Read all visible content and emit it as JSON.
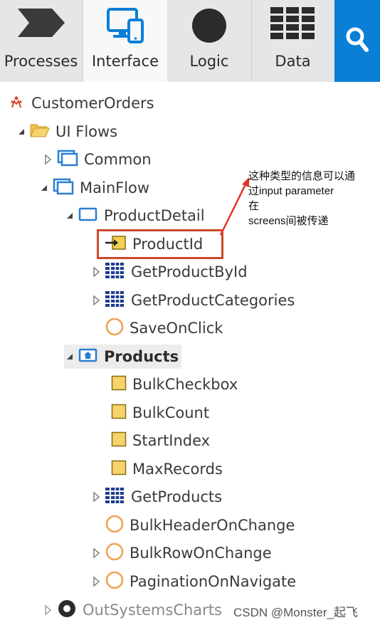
{
  "toolbar": {
    "tabs": [
      {
        "label": "Processes",
        "icon": "processes-chevron-icon",
        "active": false
      },
      {
        "label": "Interface",
        "icon": "interface-devices-icon",
        "active": true
      },
      {
        "label": "Logic",
        "icon": "logic-circle-icon",
        "active": false
      },
      {
        "label": "Data",
        "icon": "data-grid-icon",
        "active": false
      }
    ],
    "search_icon": "search-icon",
    "accent": "#0a7fd6"
  },
  "tree": {
    "root": "CustomerOrders",
    "ui_flows": "UI Flows",
    "common": "Common",
    "mainflow": "MainFlow",
    "product_detail": "ProductDetail",
    "product_id": "ProductId",
    "get_product_by_id": "GetProductById",
    "get_product_categories": "GetProductCategories",
    "save_on_click": "SaveOnClick",
    "products": "Products",
    "bulk_checkbox": "BulkCheckbox",
    "bulk_count": "BulkCount",
    "start_index": "StartIndex",
    "max_records": "MaxRecords",
    "get_products": "GetProducts",
    "bulk_header_on_change": "BulkHeaderOnChange",
    "bulk_row_on_change": "BulkRowOnChange",
    "pagination_on_navigate": "PaginationOnNavigate",
    "out_systems_charts": "OutSystemsCharts"
  },
  "annotation": {
    "line1": "这种类型的信息可以通",
    "line2": "过input parameter",
    "line3": "在",
    "line4": "screens间被传递",
    "color": "#e0332a"
  },
  "watermark": "CSDN @Monster_起飞"
}
